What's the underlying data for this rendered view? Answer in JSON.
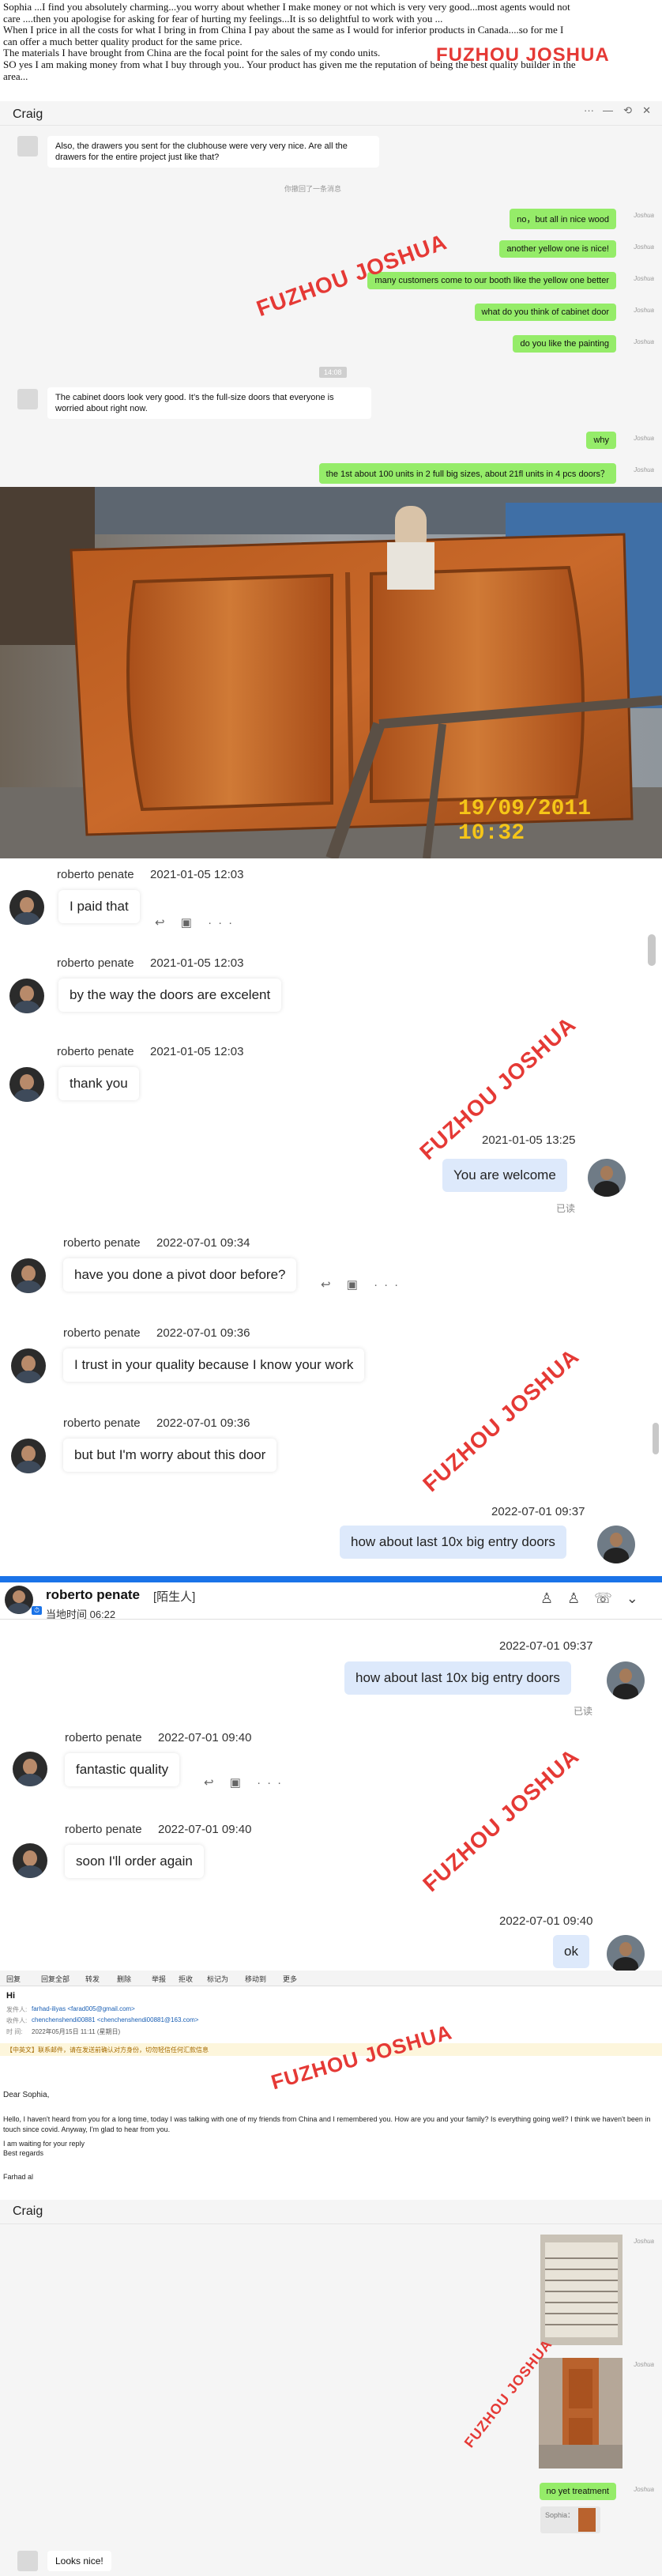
{
  "letter": {
    "lines": [
      "Sophia ...I find you absolutely charming...you worry about whether I make money or not which is very very good...most agents would not",
      "care ....then you apologise for asking for fear of hurting my feelings...It is so delightful to work with you ...",
      "When I price in all the costs for what I bring in from China I pay about the same as I would for inferior products in Canada....so for me I",
      "can offer a much better quality product for the same price.",
      "The materials I have brought from China are the focal point for the sales of my condo units.",
      "SO yes I am making money from what I buy through you.. Your product has given me the reputation of being the best quality builder in the",
      "area..."
    ]
  },
  "watermark": "FUZHOU JOSHUA",
  "wechat1": {
    "title": "Craig",
    "controls": [
      "···",
      "—",
      "⟲",
      "✕"
    ],
    "incoming1": "Also, the drawers you sent for the clubhouse were very very nice. Are all the drawers for the entire project just like that?",
    "system_note": "你撤回了一条消息",
    "outgoing1": [
      "no，but all in nice wood",
      "another yellow one is nice!",
      "many customers come to our booth like the yellow one better",
      "what do you think of cabinet door",
      "do you like the painting"
    ],
    "time_chip": "14:08",
    "incoming2": "The cabinet doors look very good. It’s the full-size doors that everyone is worried about right now.",
    "outgoing2": [
      "why",
      "the 1st about 100 units in 2 full big sizes, about 21fl units in 4 pcs doors？"
    ],
    "sig": "Joshua"
  },
  "photo": {
    "timestamp": "19/09/2011  10:32"
  },
  "chat1": {
    "messages": [
      {
        "name": "roberto penate",
        "time": "2021-01-05 12:03",
        "text": "I paid that"
      },
      {
        "name": "roberto penate",
        "time": "2021-01-05 12:03",
        "text": "by the way the doors are excelent"
      },
      {
        "name": "roberto penate",
        "time": "2021-01-05 12:03",
        "text": "thank you"
      }
    ],
    "reply_time": "2021-01-05 13:25",
    "reply_text": "You are welcome",
    "read_label": "已读"
  },
  "chat2": {
    "messages": [
      {
        "name": "roberto penate",
        "time": "2022-07-01 09:34",
        "text": "have you done a pivot door before?"
      },
      {
        "name": "roberto penate",
        "time": "2022-07-01 09:36",
        "text": "I trust in your quality because I know your work"
      },
      {
        "name": "roberto penate",
        "time": "2022-07-01 09:36",
        "text": "but but I'm worry about this door"
      }
    ],
    "reply_time": "2022-07-01 09:37",
    "reply_text": "how about last 10x big entry doors"
  },
  "chat3": {
    "header_name": "roberto penate",
    "header_tag": "[陌生人]",
    "header_local": "当地时间 06:22",
    "reply_time": "2022-07-01 09:37",
    "reply_text": "how about last 10x big entry doors",
    "read_label": "已读",
    "messages": [
      {
        "name": "roberto penate",
        "time": "2022-07-01 09:40",
        "text": "fantastic quality"
      },
      {
        "name": "roberto penate",
        "time": "2022-07-01 09:40",
        "text": "soon I'll order again"
      }
    ],
    "reply2_time": "2022-07-01 09:40",
    "reply2_text": "ok"
  },
  "email": {
    "toolbar": [
      "回复",
      "回复全部",
      "转发",
      "删除",
      "举报",
      "拒收",
      "标记为",
      "移动到",
      "更多"
    ],
    "subject": "Hi",
    "from_label": "发件人:",
    "from": "farhad-iliyas <farad005@gmail.com>",
    "to_label": "收件人:",
    "to": "chenchenshendi00881 <chenchenshendi00881@163.com>",
    "time_label": "时 间:",
    "time": "2022年05月15日 11:11 (星期日)",
    "notice": "【中英文】联系邮件，请在发送前确认对方身份，切勿轻信任何汇款信息",
    "greeting": "Dear Sophia,",
    "body": "Hello, I haven't heard from you for a long time, today I was talking with one of my friends from China and I remembered you. How are you and your family? Is everything going well? I think we haven't been in touch since covid. Anyway, I'm glad to hear from you.",
    "line2": "I am waiting for your reply",
    "line3": "Best regards",
    "sign": "Farhad al"
  },
  "wechat2": {
    "title": "Craig",
    "outgoing": "no yet treatment",
    "quote": "Sophia：",
    "incoming": "Looks nice!",
    "sig": "Joshua"
  }
}
